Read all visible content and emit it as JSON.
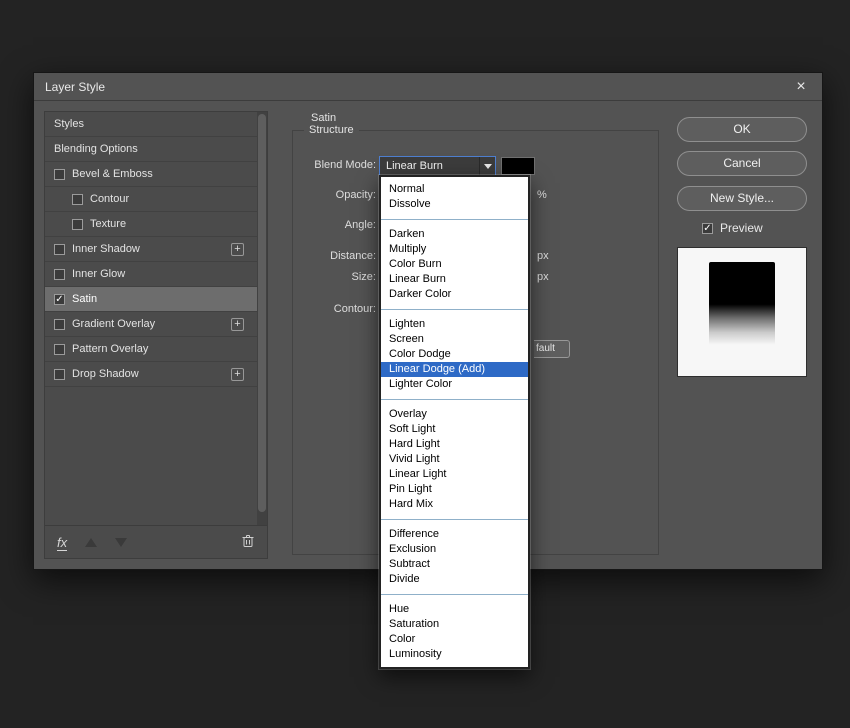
{
  "window": {
    "title": "Layer Style"
  },
  "icons": {
    "close": "×",
    "check": "✓",
    "plus": "+"
  },
  "sidebar": {
    "items": [
      {
        "label": "Styles",
        "checkbox": false,
        "checked": false,
        "selected": false,
        "indent": false,
        "plus": false
      },
      {
        "label": "Blending Options",
        "checkbox": false,
        "checked": false,
        "selected": false,
        "indent": false,
        "plus": false
      },
      {
        "label": "Bevel & Emboss",
        "checkbox": true,
        "checked": false,
        "selected": false,
        "indent": false,
        "plus": false
      },
      {
        "label": "Contour",
        "checkbox": true,
        "checked": false,
        "selected": false,
        "indent": true,
        "plus": false
      },
      {
        "label": "Texture",
        "checkbox": true,
        "checked": false,
        "selected": false,
        "indent": true,
        "plus": false
      },
      {
        "label": "Inner Shadow",
        "checkbox": true,
        "checked": false,
        "selected": false,
        "indent": false,
        "plus": true
      },
      {
        "label": "Inner Glow",
        "checkbox": true,
        "checked": false,
        "selected": false,
        "indent": false,
        "plus": false
      },
      {
        "label": "Satin",
        "checkbox": true,
        "checked": true,
        "selected": true,
        "indent": false,
        "plus": false
      },
      {
        "label": "Gradient Overlay",
        "checkbox": true,
        "checked": false,
        "selected": false,
        "indent": false,
        "plus": true
      },
      {
        "label": "Pattern Overlay",
        "checkbox": true,
        "checked": false,
        "selected": false,
        "indent": false,
        "plus": false
      },
      {
        "label": "Drop Shadow",
        "checkbox": true,
        "checked": false,
        "selected": false,
        "indent": false,
        "plus": true
      }
    ],
    "footer": {
      "fx_label": "fx"
    }
  },
  "panel": {
    "title": "Satin",
    "group": "Structure",
    "labels": {
      "blend_mode": "Blend Mode:",
      "opacity": "Opacity:",
      "angle": "Angle:",
      "distance": "Distance:",
      "size": "Size:",
      "contour": "Contour:"
    },
    "units": {
      "opacity": "%",
      "distance": "px",
      "size": "px"
    },
    "blend_mode_value": "Linear Burn",
    "partial_button_text": "fault"
  },
  "actions": {
    "ok": "OK",
    "cancel": "Cancel",
    "new_style": "New Style...",
    "preview": "Preview",
    "preview_checked": true
  },
  "dropdown": {
    "highlighted": "Linear Dodge (Add)",
    "groups": [
      [
        "Normal",
        "Dissolve"
      ],
      [
        "Darken",
        "Multiply",
        "Color Burn",
        "Linear Burn",
        "Darker Color"
      ],
      [
        "Lighten",
        "Screen",
        "Color Dodge",
        "Linear Dodge (Add)",
        "Lighter Color"
      ],
      [
        "Overlay",
        "Soft Light",
        "Hard Light",
        "Vivid Light",
        "Linear Light",
        "Pin Light",
        "Hard Mix"
      ],
      [
        "Difference",
        "Exclusion",
        "Subtract",
        "Divide"
      ],
      [
        "Hue",
        "Saturation",
        "Color",
        "Luminosity"
      ]
    ]
  },
  "colors": {
    "dialog": "#535353",
    "highlight": "#2e6ac6",
    "list_separator": "#8fb0c9",
    "swatch": "#000000"
  }
}
